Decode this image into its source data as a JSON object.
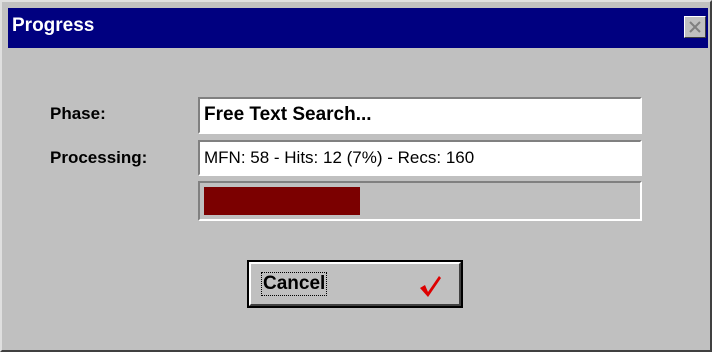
{
  "window": {
    "title": "Progress"
  },
  "form": {
    "phase_label": "Phase:",
    "phase_value": "Free Text Search...",
    "processing_label": "Processing:",
    "processing_value": "MFN: 58 - Hits: 12 (7%) - Recs: 160"
  },
  "progress": {
    "fraction": 0.36,
    "fill_color": "#7b0000"
  },
  "buttons": {
    "cancel_label": "Cancel"
  },
  "icons": {
    "close": "close-icon",
    "cancel": "check-icon",
    "check_color": "#dd0000"
  }
}
